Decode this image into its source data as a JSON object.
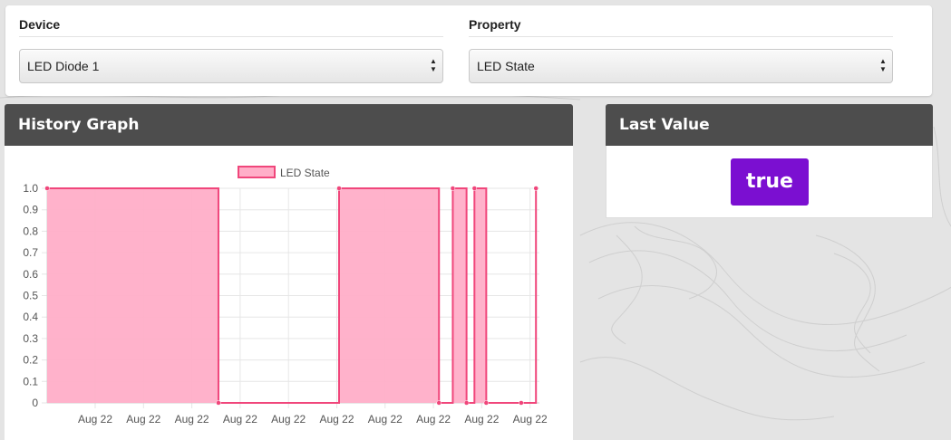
{
  "device": {
    "label": "Device",
    "selected": "LED Diode 1"
  },
  "property": {
    "label": "Property",
    "selected": "LED State"
  },
  "history": {
    "title": "History Graph"
  },
  "last_value": {
    "title": "Last Value",
    "value": "true"
  },
  "colors": {
    "accent": "#7b0fd1",
    "series_line": "#f0467b",
    "series_fill": "#ffaec8",
    "header_bg": "#4d4d4d"
  },
  "chart_data": {
    "type": "area",
    "step": true,
    "series": [
      {
        "name": "LED State",
        "points": [
          [
            0,
            1
          ],
          [
            0.348,
            1
          ],
          [
            0.348,
            0
          ],
          [
            0.593,
            0
          ],
          [
            0.593,
            1
          ],
          [
            0.796,
            1
          ],
          [
            0.796,
            0
          ],
          [
            0.824,
            0
          ],
          [
            0.824,
            1
          ],
          [
            0.852,
            1
          ],
          [
            0.852,
            0
          ],
          [
            0.868,
            0
          ],
          [
            0.868,
            1
          ],
          [
            0.892,
            1
          ],
          [
            0.892,
            0
          ],
          [
            0.963,
            0
          ],
          [
            0.993,
            0
          ],
          [
            0.993,
            1
          ]
        ],
        "markers": [
          [
            0,
            1
          ],
          [
            0.348,
            0
          ],
          [
            0.593,
            1
          ],
          [
            0.796,
            0
          ],
          [
            0.824,
            1
          ],
          [
            0.852,
            0
          ],
          [
            0.868,
            1
          ],
          [
            0.892,
            0
          ],
          [
            0.963,
            0
          ],
          [
            0.993,
            1
          ]
        ]
      }
    ],
    "x_tick_labels": [
      "Aug 22",
      "Aug 22",
      "Aug 22",
      "Aug 22",
      "Aug 22",
      "Aug 22",
      "Aug 22",
      "Aug 22",
      "Aug 22",
      "Aug 22"
    ],
    "y_ticks": [
      "0",
      "0.1",
      "0.2",
      "0.3",
      "0.4",
      "0.5",
      "0.6",
      "0.7",
      "0.8",
      "0.9",
      "1.0"
    ],
    "ylim": [
      0,
      1
    ],
    "grid": true,
    "legend": "top-center"
  }
}
